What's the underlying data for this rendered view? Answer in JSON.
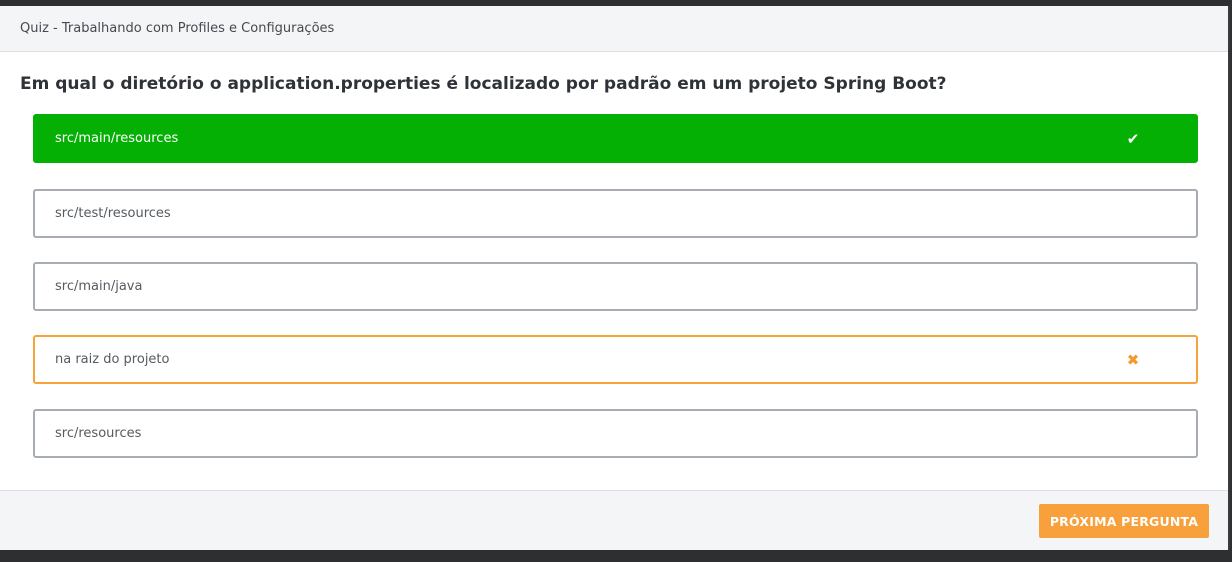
{
  "modal": {
    "title": "Quiz - Trabalhando com Profiles e Configurações"
  },
  "question": {
    "text": "Em qual o diretório o application.properties é localizado por padrão em um projeto Spring Boot?"
  },
  "options": [
    {
      "label": "src/main/resources",
      "state": "correct",
      "mark": "✔",
      "mark_icon": "check-icon"
    },
    {
      "label": "src/test/resources",
      "state": "neutral",
      "mark": "",
      "mark_icon": ""
    },
    {
      "label": "src/main/java",
      "state": "neutral",
      "mark": "",
      "mark_icon": ""
    },
    {
      "label": "na raiz do projeto",
      "state": "wrong",
      "mark": "✖",
      "mark_icon": "x-icon"
    },
    {
      "label": "src/resources",
      "state": "neutral",
      "mark": "",
      "mark_icon": ""
    }
  ],
  "footer": {
    "next_label": "PRÓXIMA PERGUNTA"
  },
  "colors": {
    "correct": "#05b005",
    "wrong": "#f7a33a",
    "accent": "#f7a03c"
  }
}
